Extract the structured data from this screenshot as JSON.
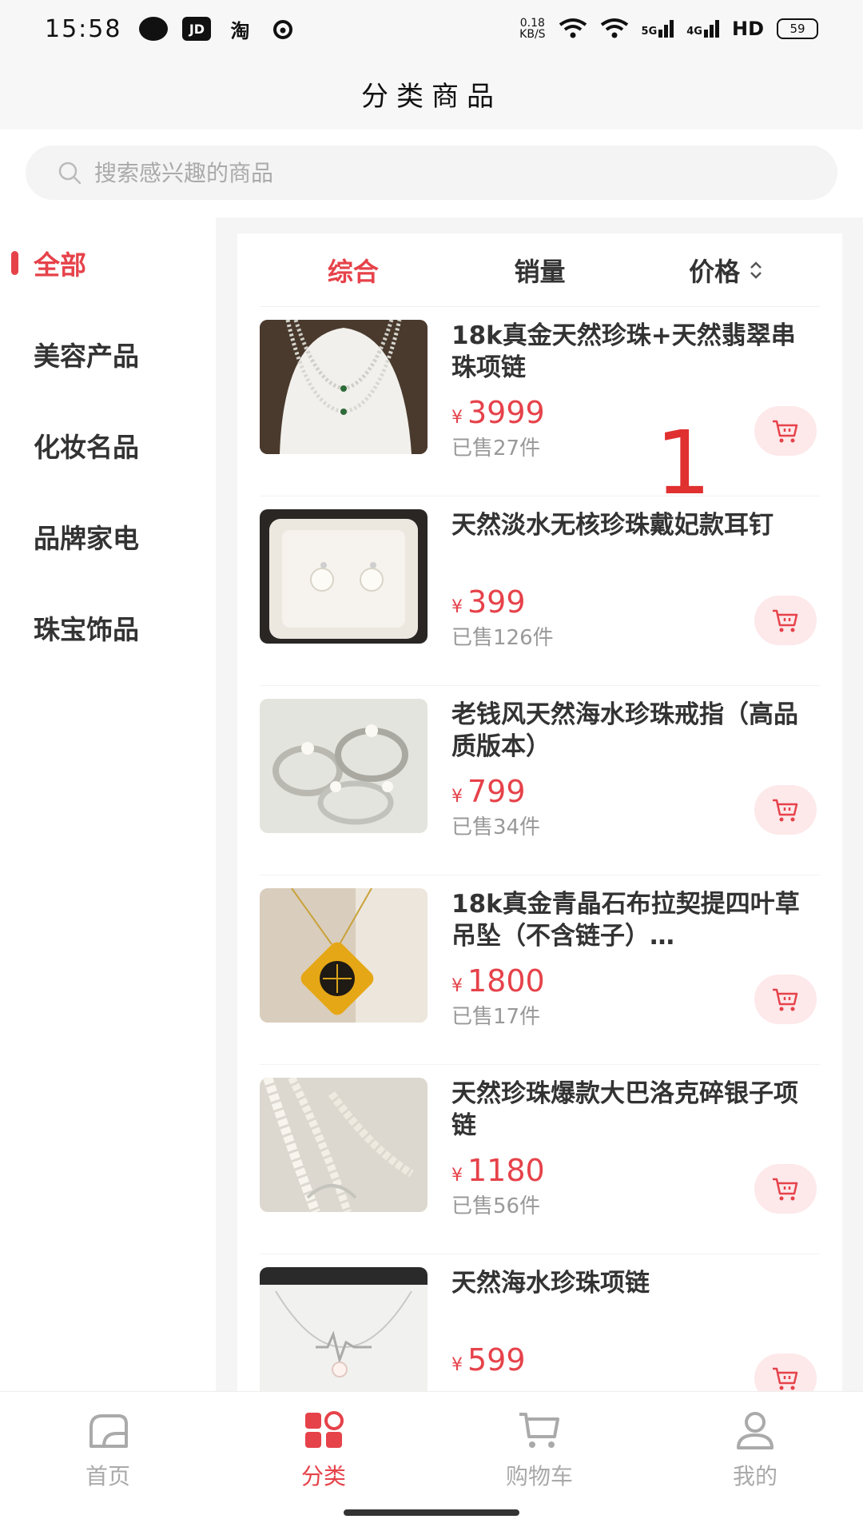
{
  "status_bar": {
    "time": "15:58",
    "net_speed_top": "0.18",
    "net_speed_bottom": "KB/S",
    "signal_1": "5G",
    "signal_2": "4G",
    "hd": "HD",
    "battery": "59",
    "app_icons": [
      "message-icon",
      "jd-icon",
      "taobao-icon",
      "weibo-icon"
    ],
    "app_icon_labels": [
      "",
      "JD",
      "淘",
      ""
    ]
  },
  "header": {
    "title": "分类商品"
  },
  "search": {
    "placeholder": "搜索感兴趣的商品"
  },
  "sidebar": {
    "items": [
      {
        "label": "全部",
        "active": true
      },
      {
        "label": "美容产品",
        "active": false
      },
      {
        "label": "化妆名品",
        "active": false
      },
      {
        "label": "品牌家电",
        "active": false
      },
      {
        "label": "珠宝饰品",
        "active": false
      }
    ]
  },
  "sort_tabs": [
    {
      "label": "综合",
      "active": true
    },
    {
      "label": "销量",
      "active": false
    },
    {
      "label": "价格",
      "active": false
    }
  ],
  "currency_symbol": "¥",
  "products": [
    {
      "title": "18k真金天然珍珠+天然翡翠串珠项链",
      "price": "3999",
      "sold": "已售27件",
      "image": "pearl-necklace-display"
    },
    {
      "title": "天然淡水无核珍珠戴妃款耳钉",
      "price": "399",
      "sold": "已售126件",
      "image": "pearl-earrings-box"
    },
    {
      "title": "老钱风天然海水珍珠戒指（高品质版本）",
      "price": "799",
      "sold": "已售34件",
      "image": "pearl-rings"
    },
    {
      "title": "18k真金青晶石布拉契提四叶草吊坠（不含链子）…",
      "price": "1800",
      "sold": "已售17件",
      "image": "clover-pendant"
    },
    {
      "title": "天然珍珠爆款大巴洛克碎银子项链",
      "price": "1180",
      "sold": "已售56件",
      "image": "baroque-pearl-necklace"
    },
    {
      "title": "天然海水珍珠项链",
      "price": "599",
      "sold": "",
      "image": "seawater-pearl-necklace"
    }
  ],
  "overlay_label": "1",
  "bottom_nav": [
    {
      "label": "首页",
      "icon": "home-icon",
      "active": false
    },
    {
      "label": "分类",
      "icon": "category-icon",
      "active": true
    },
    {
      "label": "购物车",
      "icon": "cart-icon",
      "active": false
    },
    {
      "label": "我的",
      "icon": "profile-icon",
      "active": false
    }
  ],
  "colors": {
    "accent": "#e6424a",
    "cart_bg": "#fde8ea",
    "muted": "#999999"
  }
}
